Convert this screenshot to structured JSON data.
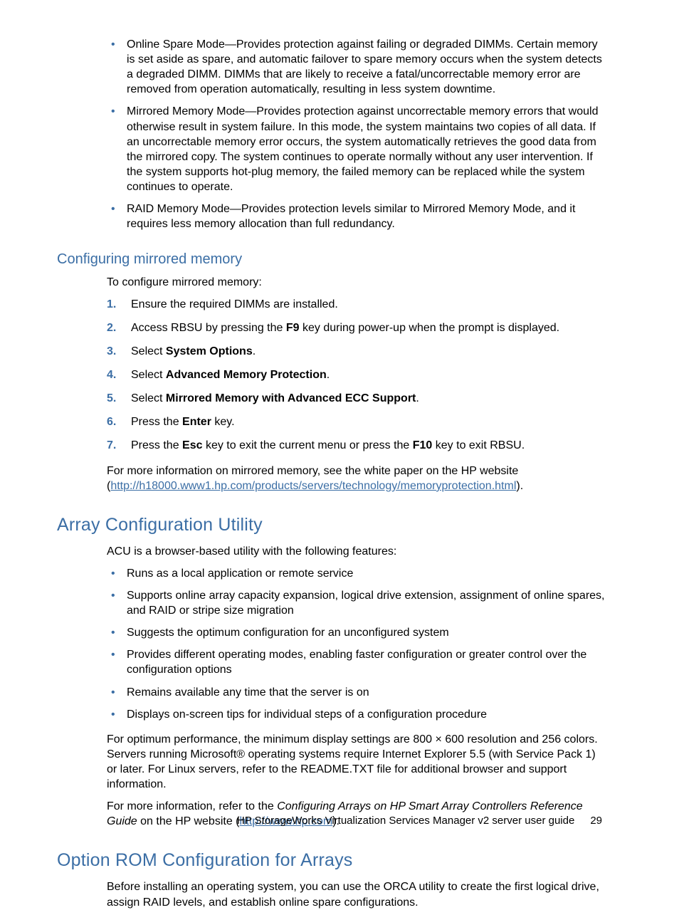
{
  "top_bullets": [
    "Online Spare Mode—Provides protection against failing or degraded DIMMs. Certain memory is set aside as spare, and automatic failover to spare memory occurs when the system detects a degraded DIMM. DIMMs that are likely to receive a fatal/uncorrectable memory error are removed from operation automatically, resulting in less system downtime.",
    "Mirrored Memory Mode—Provides protection against uncorrectable memory errors that would otherwise result in system failure. In this mode, the system maintains two copies of all data. If an uncorrectable memory error occurs, the system automatically retrieves the good data from the mirrored copy. The system continues to operate normally without any user intervention. If the system supports hot-plug memory, the failed memory can be replaced while the system continues to operate.",
    "RAID Memory Mode—Provides protection levels similar to Mirrored Memory Mode, and it requires less memory allocation than full redundancy."
  ],
  "mirrored": {
    "heading": "Configuring mirrored memory",
    "intro": "To configure mirrored memory:",
    "steps": {
      "s1": "Ensure the required DIMMs are installed.",
      "s2a": "Access RBSU by pressing the ",
      "s2b": "F9",
      "s2c": " key during power-up when the prompt is displayed.",
      "s3a": "Select ",
      "s3b": "System Options",
      "s3c": ".",
      "s4a": "Select ",
      "s4b": "Advanced Memory Protection",
      "s4c": ".",
      "s5a": "Select ",
      "s5b": "Mirrored Memory with Advanced ECC Support",
      "s5c": ".",
      "s6a": "Press the ",
      "s6b": "Enter",
      "s6c": " key.",
      "s7a": "Press the ",
      "s7b": "Esc",
      "s7c": " key to exit the current menu or press the ",
      "s7d": "F10",
      "s7e": " key to exit RBSU."
    },
    "more_a": "For more information on mirrored memory, see the white paper on the HP website (",
    "link": "http://h18000.www1.hp.com/products/servers/technology/memoryprotection.html",
    "more_b": ")."
  },
  "acu": {
    "heading": "Array Configuration Utility",
    "intro": "ACU is a browser-based utility with the following features:",
    "bullets": [
      "Runs as a local application or remote service",
      "Supports online array capacity expansion, logical drive extension, assignment of online spares, and RAID or stripe size migration",
      "Suggests the optimum configuration for an unconfigured system",
      "Provides different operating modes, enabling faster configuration or greater control over the configuration options",
      "Remains available any time that the server is on",
      "Displays on-screen tips for individual steps of a configuration procedure"
    ],
    "para1": "For optimum performance, the minimum display settings are 800 × 600 resolution and 256 colors. Servers running Microsoft® operating systems require Internet Explorer 5.5 (with Service Pack 1) or later. For Linux servers, refer to the README.TXT file for additional browser and support information.",
    "para2a": "For more information, refer to the ",
    "para2b": "Configuring Arrays on HP Smart Array Controllers Reference Guide",
    "para2c": " on the HP website (",
    "link": "http://www.hp.com",
    "para2d": ")."
  },
  "orca": {
    "heading": "Option ROM Configuration for Arrays",
    "para": "Before installing an operating system, you can use the ORCA utility to create the first logical drive, assign RAID levels, and establish online spare configurations."
  },
  "footer": {
    "title": "HP StorageWorks Virtualization Services Manager v2 server user guide",
    "page": "29"
  }
}
